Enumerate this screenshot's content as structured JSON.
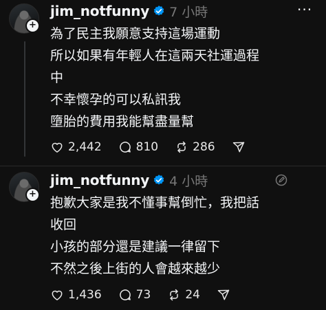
{
  "posts": [
    {
      "username": "jim_notfunny",
      "time": "7 小時",
      "more_label": "···",
      "lines": [
        "為了民主我願意支持這場運動",
        "所以如果有年輕人在這兩天社運過程",
        "中",
        "不幸懷孕的可以私訊我",
        "墮胎的費用我能幫盡量幫"
      ],
      "likes": "2,442",
      "replies": "810",
      "reposts": "286"
    },
    {
      "username": "jim_notfunny",
      "time": "4 小時",
      "lines": [
        "抱歉大家是我不懂事幫倒忙，我把話",
        "收回",
        "小孩的部分還是建議一律留下",
        "不然之後上街的人會越來越少"
      ],
      "likes": "1,436",
      "replies": "73",
      "reposts": "24"
    }
  ],
  "icons": {
    "verified": "verified-badge-icon",
    "like": "heart-icon",
    "reply": "comment-icon",
    "repost": "repost-icon",
    "share": "send-icon",
    "follow": "plus-icon",
    "edit": "edit-icon"
  },
  "colors": {
    "background": "#101010",
    "text": "#f3f5f7",
    "muted": "#777777",
    "verified": "#0095f6"
  }
}
